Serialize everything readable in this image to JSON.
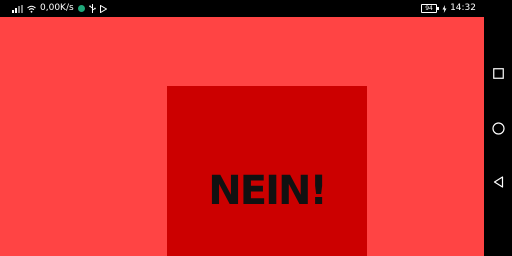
{
  "status_bar": {
    "network_speed": "0,00K/s",
    "notification_dot_color": "#1fa87a",
    "battery_level": "94",
    "time": "14:32",
    "icons": [
      "signal-icon",
      "wifi-icon",
      "notification-dot-icon",
      "usb-icon",
      "play-store-icon",
      "battery-icon",
      "charging-icon"
    ]
  },
  "app": {
    "background_color": "#ff4444",
    "card": {
      "background_color": "#cc0000",
      "text": "NEIN!"
    }
  },
  "nav_bar": {
    "buttons": [
      "recents-button",
      "home-button",
      "back-button"
    ]
  }
}
